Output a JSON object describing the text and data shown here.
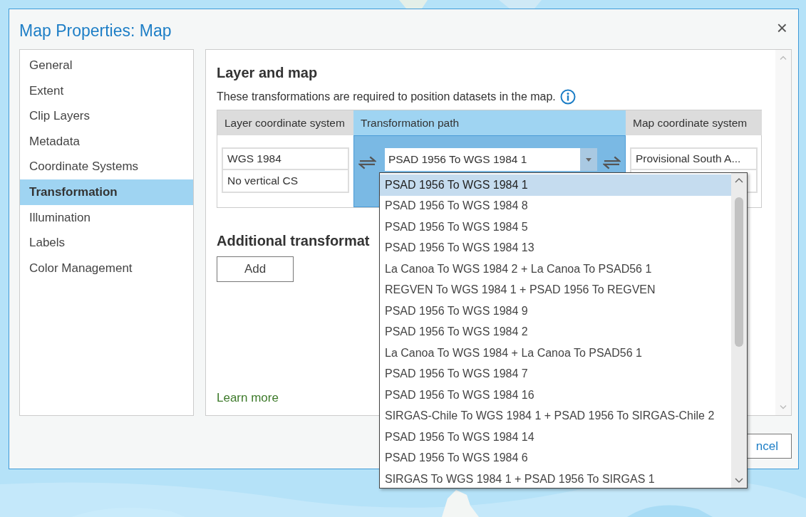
{
  "window": {
    "title": "Map Properties: Map",
    "close": "×"
  },
  "sidebar": {
    "items": [
      {
        "label": "General",
        "selected": false
      },
      {
        "label": "Extent",
        "selected": false
      },
      {
        "label": "Clip Layers",
        "selected": false
      },
      {
        "label": "Metadata",
        "selected": false
      },
      {
        "label": "Coordinate Systems",
        "selected": false
      },
      {
        "label": "Transformation",
        "selected": true
      },
      {
        "label": "Illumination",
        "selected": false
      },
      {
        "label": "Labels",
        "selected": false
      },
      {
        "label": "Color Management",
        "selected": false
      }
    ]
  },
  "panel": {
    "heading": "Layer and map",
    "description": "These transformations are required to position datasets in the map.",
    "table": {
      "columns": [
        "Layer coordinate system",
        "Transformation path",
        "Map coordinate system"
      ],
      "layer": [
        "WGS 1984",
        "No vertical CS"
      ],
      "transformation": {
        "value": "PSAD 1956 To WGS 1984 1"
      },
      "map": [
        "Provisional South A..."
      ]
    },
    "additional_heading": "Additional transformat",
    "add_button": "Add",
    "learn_more": "Learn more"
  },
  "dropdown": {
    "items": [
      {
        "label": "PSAD 1956 To WGS 1984 1",
        "selected": true
      },
      {
        "label": "PSAD 1956 To WGS 1984 8",
        "selected": false
      },
      {
        "label": "PSAD 1956 To WGS 1984 5",
        "selected": false
      },
      {
        "label": "PSAD 1956 To WGS 1984 13",
        "selected": false
      },
      {
        "label": "La Canoa To WGS 1984 2 + La Canoa To PSAD56 1",
        "selected": false
      },
      {
        "label": "REGVEN To WGS 1984 1 + PSAD 1956 To REGVEN",
        "selected": false
      },
      {
        "label": "PSAD 1956 To WGS 1984 9",
        "selected": false
      },
      {
        "label": "PSAD 1956 To WGS 1984 2",
        "selected": false
      },
      {
        "label": "La Canoa To WGS 1984 + La Canoa To PSAD56 1",
        "selected": false
      },
      {
        "label": "PSAD 1956 To WGS 1984 7",
        "selected": false
      },
      {
        "label": "PSAD 1956 To WGS 1984 16",
        "selected": false
      },
      {
        "label": "SIRGAS-Chile To WGS 1984 1 + PSAD 1956 To SIRGAS-Chile 2",
        "selected": false
      },
      {
        "label": "PSAD 1956 To WGS 1984 14",
        "selected": false
      },
      {
        "label": "PSAD 1956 To WGS 1984 6",
        "selected": false
      },
      {
        "label": "SIRGAS To WGS 1984 1 + PSAD 1956 To SIRGAS 1",
        "selected": false
      }
    ]
  },
  "buttons": [
    "ncel"
  ]
}
